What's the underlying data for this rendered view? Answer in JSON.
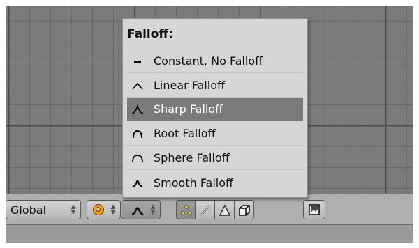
{
  "menu": {
    "title": "Falloff:",
    "items": [
      {
        "label": "Constant, No Falloff",
        "icon": "constant-falloff-icon",
        "selected": false
      },
      {
        "label": "Linear Falloff",
        "icon": "linear-falloff-icon",
        "selected": false
      },
      {
        "label": "Sharp Falloff",
        "icon": "sharp-falloff-icon",
        "selected": true
      },
      {
        "label": "Root Falloff",
        "icon": "root-falloff-icon",
        "selected": false
      },
      {
        "label": "Sphere Falloff",
        "icon": "sphere-falloff-icon",
        "selected": false
      },
      {
        "label": "Smooth Falloff",
        "icon": "smooth-falloff-icon",
        "selected": false
      }
    ]
  },
  "header": {
    "orientation_value": "Global"
  },
  "colors": {
    "viewport_bg": "#7b7b7b",
    "menu_bg": "#d6d6d6",
    "menu_highlight": "#7a7a7a",
    "header_bg": "#afafaf",
    "pivot_orange": "#f4a21c"
  }
}
